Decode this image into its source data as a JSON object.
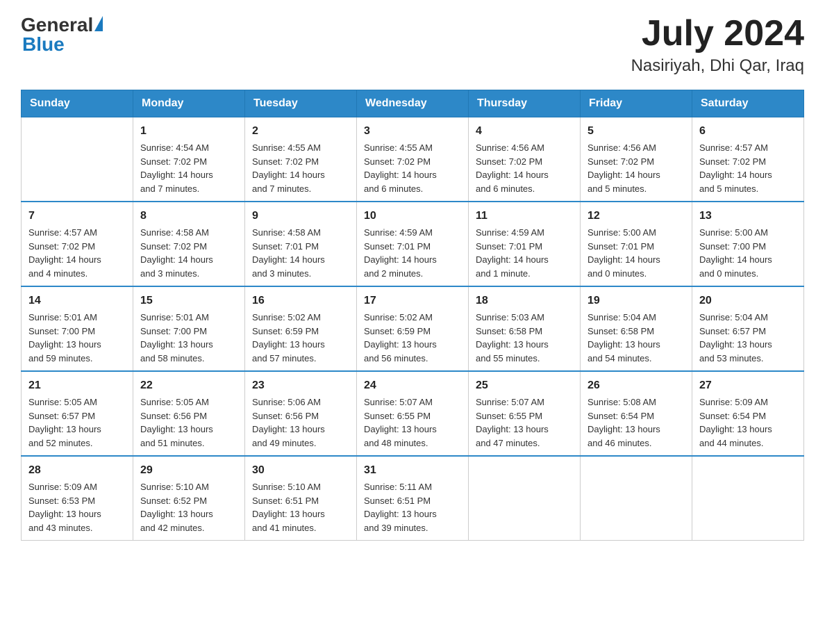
{
  "header": {
    "logo_general": "General",
    "logo_blue": "Blue",
    "title": "July 2024",
    "subtitle": "Nasiriyah, Dhi Qar, Iraq"
  },
  "days_of_week": [
    "Sunday",
    "Monday",
    "Tuesday",
    "Wednesday",
    "Thursday",
    "Friday",
    "Saturday"
  ],
  "weeks": [
    [
      {
        "day": "",
        "details": ""
      },
      {
        "day": "1",
        "details": "Sunrise: 4:54 AM\nSunset: 7:02 PM\nDaylight: 14 hours\nand 7 minutes."
      },
      {
        "day": "2",
        "details": "Sunrise: 4:55 AM\nSunset: 7:02 PM\nDaylight: 14 hours\nand 7 minutes."
      },
      {
        "day": "3",
        "details": "Sunrise: 4:55 AM\nSunset: 7:02 PM\nDaylight: 14 hours\nand 6 minutes."
      },
      {
        "day": "4",
        "details": "Sunrise: 4:56 AM\nSunset: 7:02 PM\nDaylight: 14 hours\nand 6 minutes."
      },
      {
        "day": "5",
        "details": "Sunrise: 4:56 AM\nSunset: 7:02 PM\nDaylight: 14 hours\nand 5 minutes."
      },
      {
        "day": "6",
        "details": "Sunrise: 4:57 AM\nSunset: 7:02 PM\nDaylight: 14 hours\nand 5 minutes."
      }
    ],
    [
      {
        "day": "7",
        "details": "Sunrise: 4:57 AM\nSunset: 7:02 PM\nDaylight: 14 hours\nand 4 minutes."
      },
      {
        "day": "8",
        "details": "Sunrise: 4:58 AM\nSunset: 7:02 PM\nDaylight: 14 hours\nand 3 minutes."
      },
      {
        "day": "9",
        "details": "Sunrise: 4:58 AM\nSunset: 7:01 PM\nDaylight: 14 hours\nand 3 minutes."
      },
      {
        "day": "10",
        "details": "Sunrise: 4:59 AM\nSunset: 7:01 PM\nDaylight: 14 hours\nand 2 minutes."
      },
      {
        "day": "11",
        "details": "Sunrise: 4:59 AM\nSunset: 7:01 PM\nDaylight: 14 hours\nand 1 minute."
      },
      {
        "day": "12",
        "details": "Sunrise: 5:00 AM\nSunset: 7:01 PM\nDaylight: 14 hours\nand 0 minutes."
      },
      {
        "day": "13",
        "details": "Sunrise: 5:00 AM\nSunset: 7:00 PM\nDaylight: 14 hours\nand 0 minutes."
      }
    ],
    [
      {
        "day": "14",
        "details": "Sunrise: 5:01 AM\nSunset: 7:00 PM\nDaylight: 13 hours\nand 59 minutes."
      },
      {
        "day": "15",
        "details": "Sunrise: 5:01 AM\nSunset: 7:00 PM\nDaylight: 13 hours\nand 58 minutes."
      },
      {
        "day": "16",
        "details": "Sunrise: 5:02 AM\nSunset: 6:59 PM\nDaylight: 13 hours\nand 57 minutes."
      },
      {
        "day": "17",
        "details": "Sunrise: 5:02 AM\nSunset: 6:59 PM\nDaylight: 13 hours\nand 56 minutes."
      },
      {
        "day": "18",
        "details": "Sunrise: 5:03 AM\nSunset: 6:58 PM\nDaylight: 13 hours\nand 55 minutes."
      },
      {
        "day": "19",
        "details": "Sunrise: 5:04 AM\nSunset: 6:58 PM\nDaylight: 13 hours\nand 54 minutes."
      },
      {
        "day": "20",
        "details": "Sunrise: 5:04 AM\nSunset: 6:57 PM\nDaylight: 13 hours\nand 53 minutes."
      }
    ],
    [
      {
        "day": "21",
        "details": "Sunrise: 5:05 AM\nSunset: 6:57 PM\nDaylight: 13 hours\nand 52 minutes."
      },
      {
        "day": "22",
        "details": "Sunrise: 5:05 AM\nSunset: 6:56 PM\nDaylight: 13 hours\nand 51 minutes."
      },
      {
        "day": "23",
        "details": "Sunrise: 5:06 AM\nSunset: 6:56 PM\nDaylight: 13 hours\nand 49 minutes."
      },
      {
        "day": "24",
        "details": "Sunrise: 5:07 AM\nSunset: 6:55 PM\nDaylight: 13 hours\nand 48 minutes."
      },
      {
        "day": "25",
        "details": "Sunrise: 5:07 AM\nSunset: 6:55 PM\nDaylight: 13 hours\nand 47 minutes."
      },
      {
        "day": "26",
        "details": "Sunrise: 5:08 AM\nSunset: 6:54 PM\nDaylight: 13 hours\nand 46 minutes."
      },
      {
        "day": "27",
        "details": "Sunrise: 5:09 AM\nSunset: 6:54 PM\nDaylight: 13 hours\nand 44 minutes."
      }
    ],
    [
      {
        "day": "28",
        "details": "Sunrise: 5:09 AM\nSunset: 6:53 PM\nDaylight: 13 hours\nand 43 minutes."
      },
      {
        "day": "29",
        "details": "Sunrise: 5:10 AM\nSunset: 6:52 PM\nDaylight: 13 hours\nand 42 minutes."
      },
      {
        "day": "30",
        "details": "Sunrise: 5:10 AM\nSunset: 6:51 PM\nDaylight: 13 hours\nand 41 minutes."
      },
      {
        "day": "31",
        "details": "Sunrise: 5:11 AM\nSunset: 6:51 PM\nDaylight: 13 hours\nand 39 minutes."
      },
      {
        "day": "",
        "details": ""
      },
      {
        "day": "",
        "details": ""
      },
      {
        "day": "",
        "details": ""
      }
    ]
  ]
}
